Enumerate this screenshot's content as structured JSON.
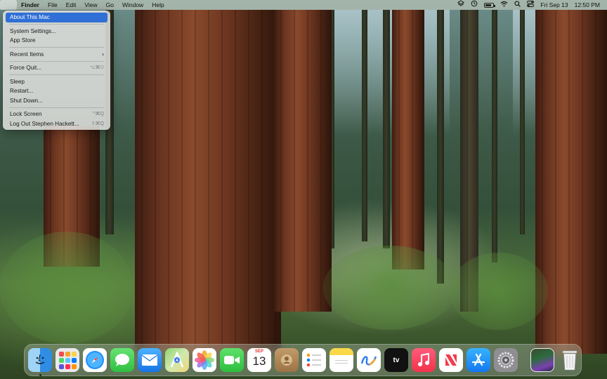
{
  "menubar": {
    "apple_glyph": "",
    "app_name": "Finder",
    "menus": [
      "File",
      "Edit",
      "View",
      "Go",
      "Window",
      "Help"
    ],
    "status_icons": [
      "layers-icon",
      "time-machine-icon",
      "battery-icon",
      "wifi-icon",
      "search-icon",
      "control-center-icon"
    ],
    "date": "Fri Sep 13",
    "time": "12:50 PM"
  },
  "apple_menu": {
    "items": [
      {
        "label": "About This Mac",
        "shortcut": "",
        "highlight": true
      },
      {
        "label": "System Settings...",
        "shortcut": ""
      },
      {
        "label": "App Store",
        "shortcut": ""
      },
      {
        "label": "Recent Items",
        "shortcut": ""
      },
      {
        "label": "Force Quit...",
        "shortcut": "⌥⌘⎋"
      },
      {
        "label": "Sleep",
        "shortcut": ""
      },
      {
        "label": "Restart...",
        "shortcut": ""
      },
      {
        "label": "Shut Down...",
        "shortcut": ""
      },
      {
        "label": "Lock Screen",
        "shortcut": "^⌘Q"
      },
      {
        "label": "Log Out Stephen Hackett...",
        "shortcut": "⇧⌘Q"
      }
    ],
    "highlight_color": "#2f6fd6"
  },
  "dock": {
    "calendar_month": "SEP",
    "calendar_day": "13",
    "tv_label": "tv",
    "apps": [
      "finder-icon",
      "launchpad-icon",
      "safari-icon",
      "messages-icon",
      "mail-icon",
      "maps-icon",
      "photos-icon",
      "facetime-icon",
      "calendar-icon",
      "contacts-icon",
      "reminders-icon",
      "notes-icon",
      "freeform-icon",
      "apple-tv-icon",
      "music-icon",
      "news-icon",
      "app-store-icon",
      "system-settings-icon",
      "downloads-stack-icon",
      "trash-icon"
    ]
  }
}
